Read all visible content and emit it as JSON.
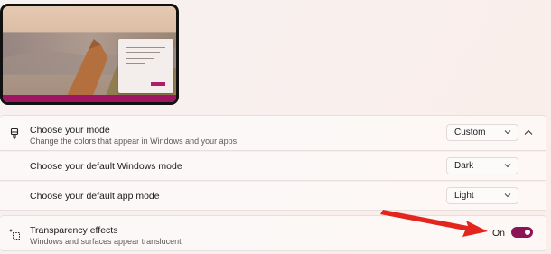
{
  "colors": {
    "accent": "#8a1454",
    "annotation_arrow": "#e3251e"
  },
  "mode": {
    "title": "Choose your mode",
    "subtitle": "Change the colors that appear in Windows and your apps",
    "value": "Custom",
    "icon": "brush-icon",
    "expanded": true
  },
  "windows_mode": {
    "title": "Choose your default Windows mode",
    "value": "Dark"
  },
  "app_mode": {
    "title": "Choose your default app mode",
    "value": "Light"
  },
  "transparency": {
    "title": "Transparency effects",
    "subtitle": "Windows and surfaces appear translucent",
    "state_label": "On",
    "enabled": true,
    "icon": "transparency-icon"
  }
}
